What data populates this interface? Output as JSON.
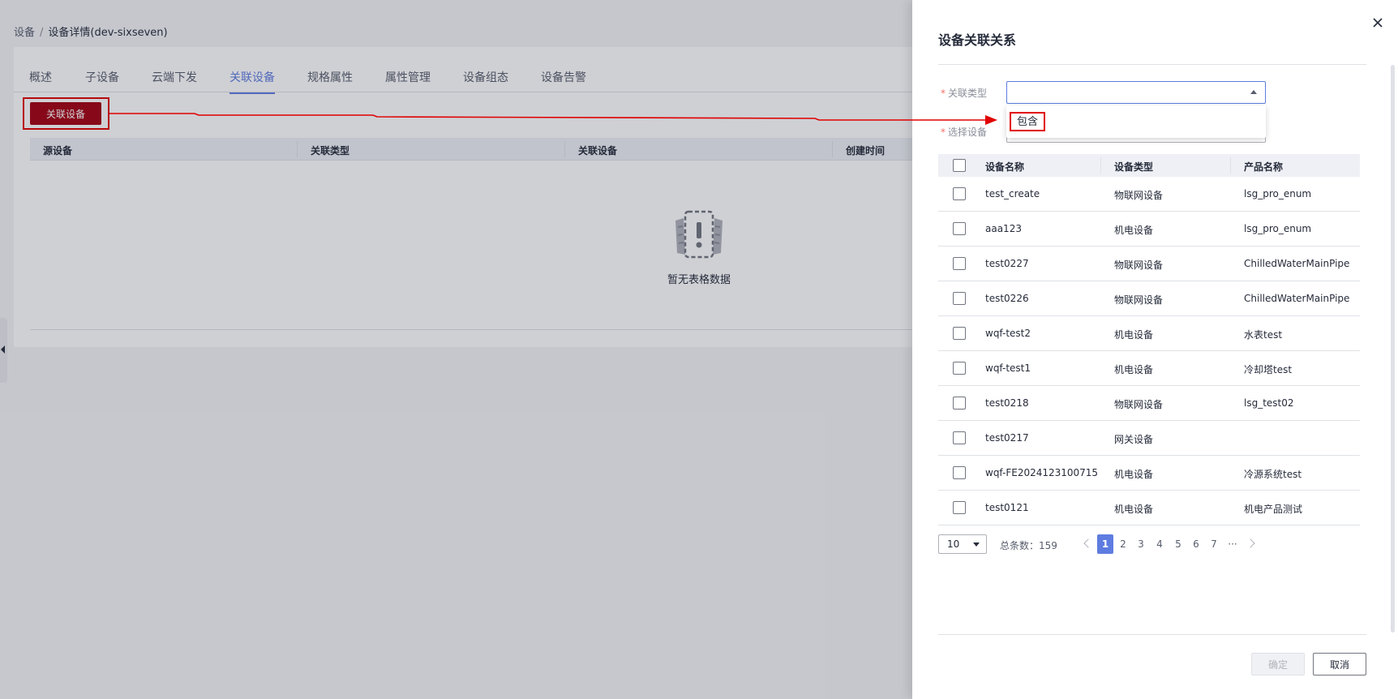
{
  "breadcrumb": {
    "root": "设备",
    "separator": "/",
    "current": "设备详情(dev-sixseven)"
  },
  "tabs": [
    {
      "label": "概述"
    },
    {
      "label": "子设备"
    },
    {
      "label": "云端下发"
    },
    {
      "label": "关联设备"
    },
    {
      "label": "规格属性"
    },
    {
      "label": "属性管理"
    },
    {
      "label": "设备组态"
    },
    {
      "label": "设备告警"
    }
  ],
  "toolbar": {
    "associate_label": "关联设备"
  },
  "bg_table": {
    "columns": [
      "源设备",
      "关联类型",
      "关联设备",
      "创建时间"
    ],
    "empty_text": "暂无表格数据"
  },
  "drawer": {
    "title": "设备关联关系",
    "form": {
      "relation_type_label": "关联类型",
      "select_device_label": "选择设备",
      "required_mark": "*",
      "relation_type_value": ""
    },
    "dropdown_options": [
      "包含"
    ],
    "table": {
      "columns": [
        "设备名称",
        "设备类型",
        "产品名称"
      ],
      "rows": [
        {
          "name": "test_create",
          "type": "物联网设备",
          "product": "lsg_pro_enum"
        },
        {
          "name": "aaa123",
          "type": "机电设备",
          "product": "lsg_pro_enum"
        },
        {
          "name": "test0227",
          "type": "物联网设备",
          "product": "ChilledWaterMainPipe"
        },
        {
          "name": "test0226",
          "type": "物联网设备",
          "product": "ChilledWaterMainPipe"
        },
        {
          "name": "wqf-test2",
          "type": "机电设备",
          "product": "水表test"
        },
        {
          "name": "wqf-test1",
          "type": "机电设备",
          "product": "冷却塔test"
        },
        {
          "name": "test0218",
          "type": "物联网设备",
          "product": "lsg_test02"
        },
        {
          "name": "test0217",
          "type": "网关设备",
          "product": ""
        },
        {
          "name": "wqf-FE2024123100715",
          "type": "机电设备",
          "product": "冷源系统test"
        },
        {
          "name": "test0121",
          "type": "机电设备",
          "product": "机电产品测试"
        }
      ]
    },
    "pagination": {
      "page_size": "10",
      "total_label": "总条数：159",
      "pages": [
        "1",
        "2",
        "3",
        "4",
        "5",
        "6",
        "7"
      ],
      "ellipsis": "···",
      "current": "1"
    },
    "ok_label": "确定",
    "cancel_label": "取消"
  },
  "colors": {
    "primary": "#5e7ce0",
    "danger_button": "#a30010",
    "annotation_red": "#e00000"
  }
}
